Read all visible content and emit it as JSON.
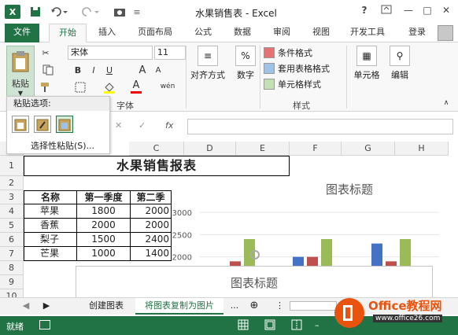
{
  "titlebar": {
    "app_logo": "X",
    "title": "水果销售表 - Excel",
    "icons": [
      "save-icon",
      "undo-icon",
      "redo-icon",
      "camera-icon"
    ],
    "help": "?",
    "minimize": "—",
    "restore": "□",
    "close": "✕"
  },
  "tabs": {
    "file": "文件",
    "items": [
      "开始",
      "插入",
      "页面布局",
      "公式",
      "数据",
      "审阅",
      "视图",
      "开发工具"
    ],
    "login": "登录"
  },
  "ribbon": {
    "paste_label": "粘贴",
    "font_name": "宋体",
    "font_size": "11",
    "bold": "B",
    "italic": "I",
    "underline": "U",
    "grow_font": "A",
    "shrink_font": "A",
    "font_color_glyph": "A",
    "phonetic": "wén",
    "font_group_label": "字体",
    "align_label": "对齐方式",
    "number_label": "数字",
    "number_glyph": "%",
    "cond_format": "条件格式",
    "table_format": "套用表格格式",
    "cell_style": "单元格样式",
    "styles_group_label": "样式",
    "cells_label": "单元格",
    "edit_label": "编辑"
  },
  "paste_menu": {
    "title": "粘贴选项:",
    "special": "选择性粘贴(S)..."
  },
  "formula_bar": {
    "cancel": "✕",
    "enter": "✓",
    "fx": "fx",
    "value": ""
  },
  "grid": {
    "columns": [
      "C",
      "D",
      "E",
      "F",
      "G",
      "H"
    ],
    "rows": [
      "1",
      "2",
      "3",
      "4",
      "5",
      "6",
      "7",
      "8",
      "9",
      "10"
    ],
    "sheet_title": "水果销售报表",
    "table": {
      "headers": [
        "名称",
        "第一季度",
        "第二季"
      ],
      "rows": [
        [
          "苹果",
          "1800",
          "2000"
        ],
        [
          "香蕉",
          "2000",
          "2000"
        ],
        [
          "梨子",
          "1500",
          "2400"
        ],
        [
          "芒果",
          "1000",
          "1400"
        ]
      ]
    }
  },
  "chart_data": {
    "type": "bar",
    "title": "图表标题",
    "y_ticks": [
      "3000",
      "2500",
      "2000"
    ],
    "ylim": [
      1800,
      3000
    ],
    "series": [
      {
        "color": "#4472c4",
        "values": [
          1800,
          2000,
          2300
        ]
      },
      {
        "color": "#c0504d",
        "values": [
          1900,
          2000,
          1900
        ]
      },
      {
        "color": "#9bbb59",
        "values": [
          2400,
          2400,
          2400
        ]
      }
    ]
  },
  "chart2": {
    "title": "图表标题"
  },
  "sheet_tabs": {
    "items": [
      "创建图表",
      "将图表复制为图片"
    ],
    "more": "...",
    "add": "⊕"
  },
  "status": {
    "ready": "就绪"
  },
  "watermark": {
    "text": "Office教程网",
    "url": "www.office26.com"
  }
}
